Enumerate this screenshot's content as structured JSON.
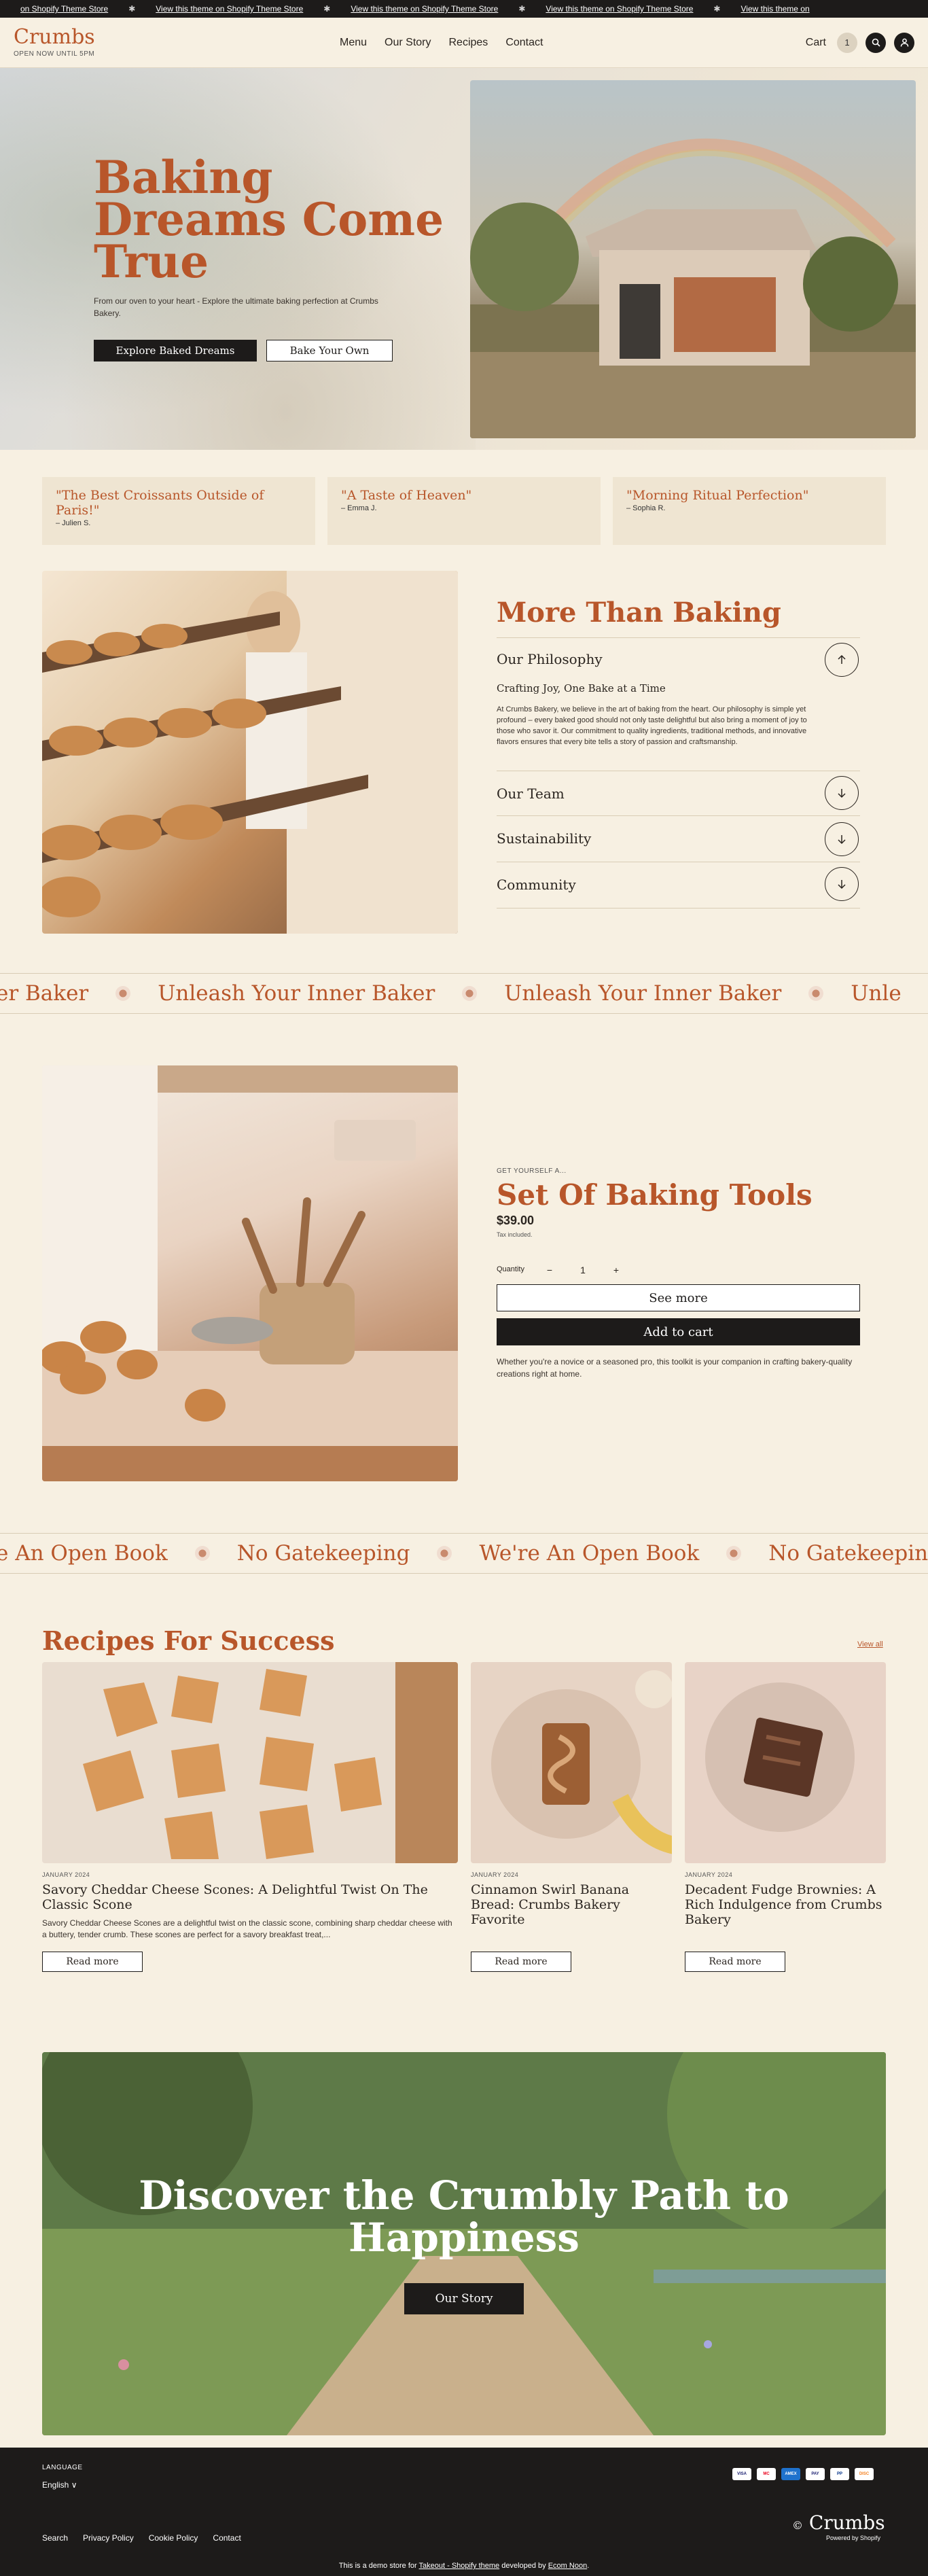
{
  "announcement": {
    "text": "View this theme on Shopify Theme Store",
    "repeat": [
      "on Shopify Theme Store",
      "View this theme on Shopify Theme Store",
      "View this theme on Shopify Theme Store",
      "View this theme on Shopify Theme Store",
      "View this theme on"
    ]
  },
  "header": {
    "brand": "Crumbs",
    "brand_sub": "OPEN NOW UNTIL 5PM",
    "nav": [
      "Menu",
      "Our Story",
      "Recipes",
      "Contact"
    ],
    "cart_label": "Cart",
    "cart_count": "1"
  },
  "hero": {
    "title": "Baking Dreams Come True",
    "description": "From our oven to your heart - Explore the ultimate baking perfection at Crumbs Bakery.",
    "primary_button": "Explore Baked Dreams",
    "secondary_button": "Bake Your Own"
  },
  "testimonials": [
    {
      "quote": "\"The Best Croissants Outside of Paris!\"",
      "author": "– Julien S."
    },
    {
      "quote": "\"A Taste of Heaven\"",
      "author": "– Emma J."
    },
    {
      "quote": "\"Morning Ritual Perfection\"",
      "author": "– Sophia R."
    }
  ],
  "about": {
    "title": "More Than Baking",
    "items": [
      {
        "label": "Our Philosophy",
        "open": true
      },
      {
        "label": "Our Team",
        "open": false
      },
      {
        "label": "Sustainability",
        "open": false
      },
      {
        "label": "Community",
        "open": false
      }
    ],
    "open_subtitle": "Crafting Joy, One Bake at a Time",
    "open_body": "At Crumbs Bakery, we believe in the art of baking from the heart. Our philosophy is simple yet profound – every baked good should not only taste delightful but also bring a moment of joy to those who savor it. Our commitment to quality ingredients, traditional methods, and innovative flavors ensures that every bite tells a story of passion and craftsmanship."
  },
  "marquee1": {
    "items": [
      "er Baker",
      "Unleash Your Inner Baker",
      "Unleash Your Inner Baker",
      "Unle"
    ]
  },
  "product": {
    "eyebrow": "GET YOURSELF A...",
    "title": "Set Of Baking Tools",
    "price": "$39.00",
    "tax_note": "Tax included.",
    "quantity_label": "Quantity",
    "quantity": "1",
    "see_more": "See more",
    "add_to_cart": "Add to cart",
    "note": "Whether you're a novice or a seasoned pro, this toolkit is your companion in crafting bakery-quality creations right at home."
  },
  "marquee2": {
    "items": [
      "e An Open Book",
      "No Gatekeeping",
      "We're An Open Book",
      "No Gatekeeping"
    ]
  },
  "recipes": {
    "title": "Recipes For Success",
    "view_all": "View all",
    "posts": [
      {
        "date": "JANUARY 2024",
        "title": "Savory Cheddar Cheese Scones: A Delightful Twist On The Classic Scone",
        "excerpt": "Savory Cheddar Cheese Scones are a delightful twist on the classic scone, combining sharp cheddar cheese with a buttery, tender crumb. These scones are perfect for a savory breakfast treat,...",
        "button": "Read more"
      },
      {
        "date": "JANUARY 2024",
        "title": "Cinnamon Swirl Banana Bread: Crumbs Bakery Favorite",
        "excerpt": "",
        "button": "Read more"
      },
      {
        "date": "JANUARY 2024",
        "title": "Decadent Fudge Brownies: A Rich Indulgence from Crumbs Bakery",
        "excerpt": "",
        "button": "Read more"
      }
    ]
  },
  "banner": {
    "title": "Discover the Crumbly Path to Happiness",
    "button": "Our Story"
  },
  "footer": {
    "language_label": "LANGUAGE",
    "language": "English ∨",
    "payments": [
      "VISA",
      "MC",
      "AMEX",
      "PAY",
      "PP",
      "DISC"
    ],
    "links": [
      "Search",
      "Privacy Policy",
      "Cookie Policy",
      "Contact"
    ],
    "brand": "Crumbs",
    "copyright": "©",
    "powered": "Powered by Shopify",
    "note_prefix": "This is a demo store for ",
    "note_link1": "Takeout - Shopify theme",
    "note_mid": " developed by ",
    "note_link2": "Ecom Noon",
    "note_suffix": "."
  }
}
